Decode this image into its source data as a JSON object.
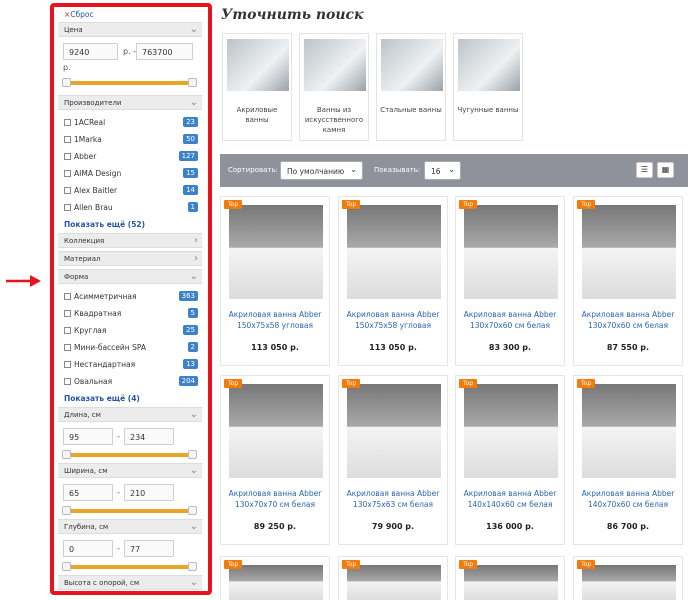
{
  "sidebar": {
    "reset_icon": "×",
    "reset_label": "Сброс",
    "price": {
      "title": "Цена",
      "min": "9240",
      "sep": "р. -",
      "max": "763700",
      "unit": "р."
    },
    "manufacturers": {
      "title": "Производители",
      "items": [
        {
          "label": "1ACReal",
          "count": "23"
        },
        {
          "label": "1Marka",
          "count": "50"
        },
        {
          "label": "Abber",
          "count": "127"
        },
        {
          "label": "AIMA Design",
          "count": "15"
        },
        {
          "label": "Alex Baitler",
          "count": "14"
        },
        {
          "label": "Allen Brau",
          "count": "1"
        }
      ],
      "more": "Показать ещё (52)"
    },
    "collection": "Коллекция",
    "material": "Материал",
    "shape": {
      "title": "Форма",
      "items": [
        {
          "label": "Асимметричная",
          "count": "363"
        },
        {
          "label": "Квадратная",
          "count": "5"
        },
        {
          "label": "Круглая",
          "count": "25"
        },
        {
          "label": "Мини-бассейн SPA",
          "count": "2"
        },
        {
          "label": "Нестандартная",
          "count": "13"
        },
        {
          "label": "Овальная",
          "count": "204"
        }
      ],
      "more": "Показать ещё (4)"
    },
    "length": {
      "title": "Длина, см",
      "min": "95",
      "sep": "-",
      "max": "234"
    },
    "width": {
      "title": "Ширина, см",
      "min": "65",
      "sep": "-",
      "max": "210"
    },
    "depth": {
      "title": "Глубина, см",
      "min": "0",
      "sep": "-",
      "max": "77"
    },
    "last_section": "Высота с опорой, см"
  },
  "main": {
    "title": "Уточнить поиск",
    "categories": [
      {
        "label": "Акриловые ванны"
      },
      {
        "label": "Ванны из искусственного камня"
      },
      {
        "label": "Стальные ванны"
      },
      {
        "label": "Чугунные ванны"
      }
    ],
    "toolbar": {
      "sort_label": "Сортировать:",
      "sort_value": "По умолчанию",
      "show_label": "Показывать:",
      "show_value": "16"
    },
    "badge": "Top",
    "products": [
      {
        "name": "Акриловая ванна Abber 150x75x58 угловая",
        "price": "113 050 р."
      },
      {
        "name": "Акриловая ванна Abber 150x75x58 угловая",
        "price": "113 050 р."
      },
      {
        "name": "Акриловая ванна Abber 130x70x60 см белая",
        "price": "83 300 р."
      },
      {
        "name": "Акриловая ванна Abber 130x70x60 см белая",
        "price": "87 550 р."
      },
      {
        "name": "Акриловая ванна Abber 130x70x70 см белая",
        "price": "89 250 р."
      },
      {
        "name": "Акриловая ванна Abber 130x75x63 см белая",
        "price": "79 900 р."
      },
      {
        "name": "Акриловая ванна Abber 140x140x60 см белая",
        "price": "136 000 р."
      },
      {
        "name": "Акриловая ванна Abber 140x70x60 см белая",
        "price": "86 700 р."
      }
    ]
  }
}
